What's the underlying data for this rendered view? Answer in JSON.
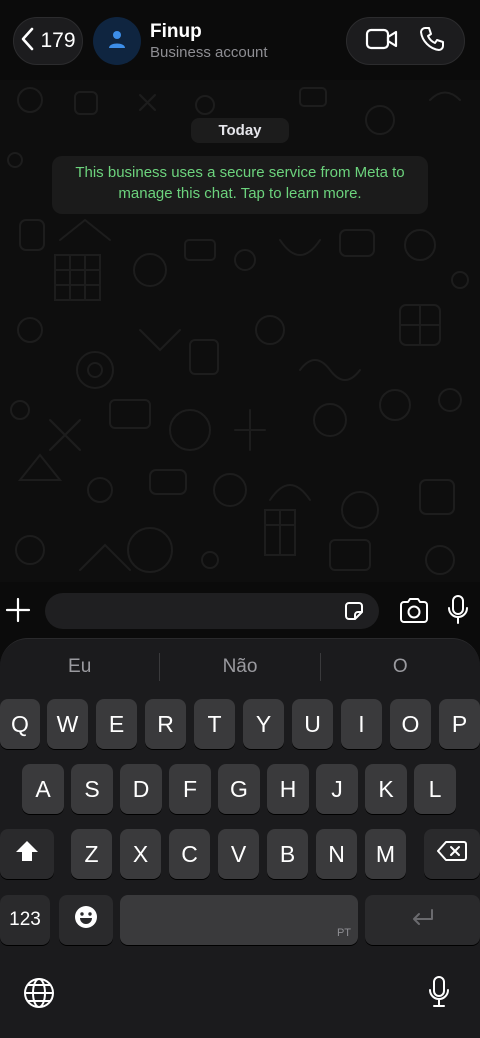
{
  "header": {
    "back_count": "179",
    "title": "Finup",
    "subtitle": "Business account",
    "icons": [
      "chevron-left-icon",
      "person-icon",
      "video-icon",
      "phone-icon"
    ]
  },
  "chat": {
    "date_label": "Today",
    "system_message": "This business uses a secure service from Meta to manage this chat. Tap to learn more."
  },
  "composer": {
    "input_value": "",
    "icons": [
      "plus-icon",
      "sticker-icon",
      "camera-icon",
      "microphone-icon"
    ]
  },
  "keyboard": {
    "suggestions": [
      "Eu",
      "Não",
      "O"
    ],
    "rows": [
      [
        "Q",
        "W",
        "E",
        "R",
        "T",
        "Y",
        "U",
        "I",
        "O",
        "P"
      ],
      [
        "A",
        "S",
        "D",
        "F",
        "G",
        "H",
        "J",
        "K",
        "L"
      ],
      [
        "Z",
        "X",
        "C",
        "V",
        "B",
        "N",
        "M"
      ]
    ],
    "numbers_label": "123",
    "space_language": "PT",
    "icons": [
      "shift-icon",
      "backspace-icon",
      "emoji-icon",
      "return-icon",
      "globe-icon",
      "microphone-icon"
    ]
  },
  "colors": {
    "background": "#0b0b0b",
    "system_text": "#6cd37d",
    "key": "#3a3a3c",
    "keyboard_bg": "#1b1b1d"
  }
}
